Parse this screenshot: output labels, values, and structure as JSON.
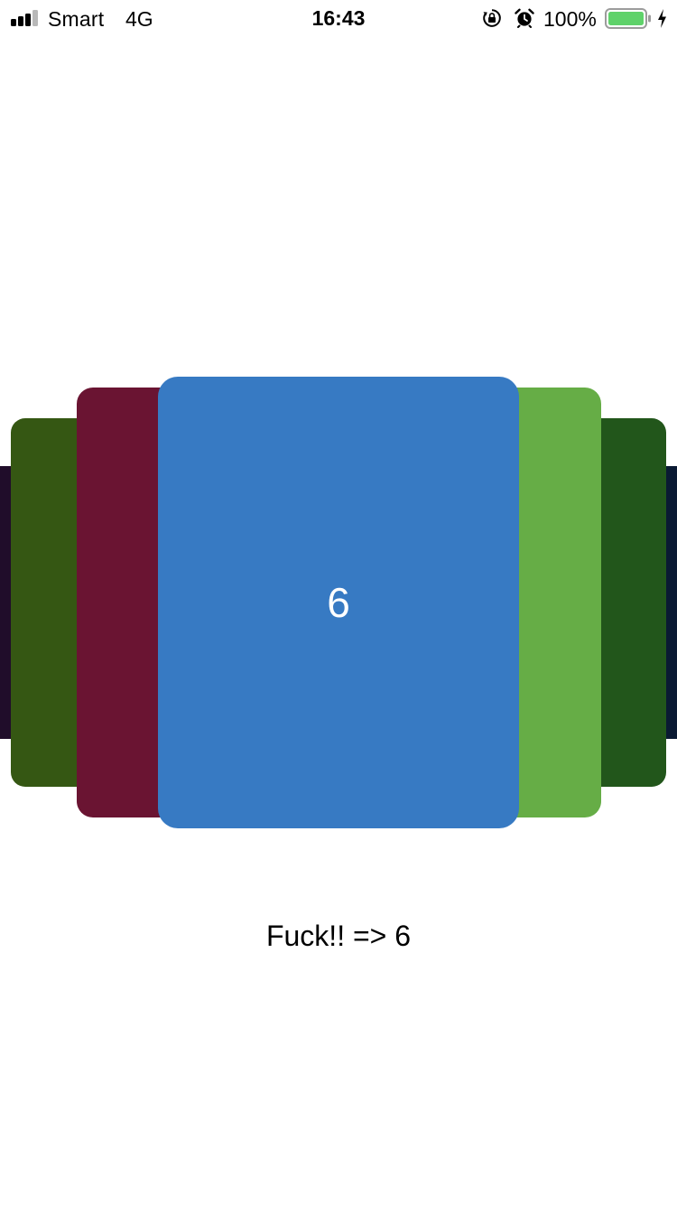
{
  "status_bar": {
    "carrier": "Smart",
    "network": "4G",
    "time": "16:43",
    "battery_percent": "100%",
    "signal_bars_active": 3,
    "signal_bars_total": 4,
    "battery_level": 1.0,
    "battery_color": "#5fd26a",
    "icons": [
      "signal-icon",
      "rotation-lock-icon",
      "alarm-icon",
      "battery-icon",
      "charging-icon"
    ]
  },
  "carousel": {
    "active_card_label": "6",
    "card_colors": {
      "far_left": "#200d2a",
      "left_2": "#355713",
      "left_1": "#6a1432",
      "center": "#377ac3",
      "right_1": "#66ad46",
      "right_2": "#22561b",
      "far_right": "#0a1a33"
    }
  },
  "caption": {
    "text": "Fuck!! => 6"
  }
}
